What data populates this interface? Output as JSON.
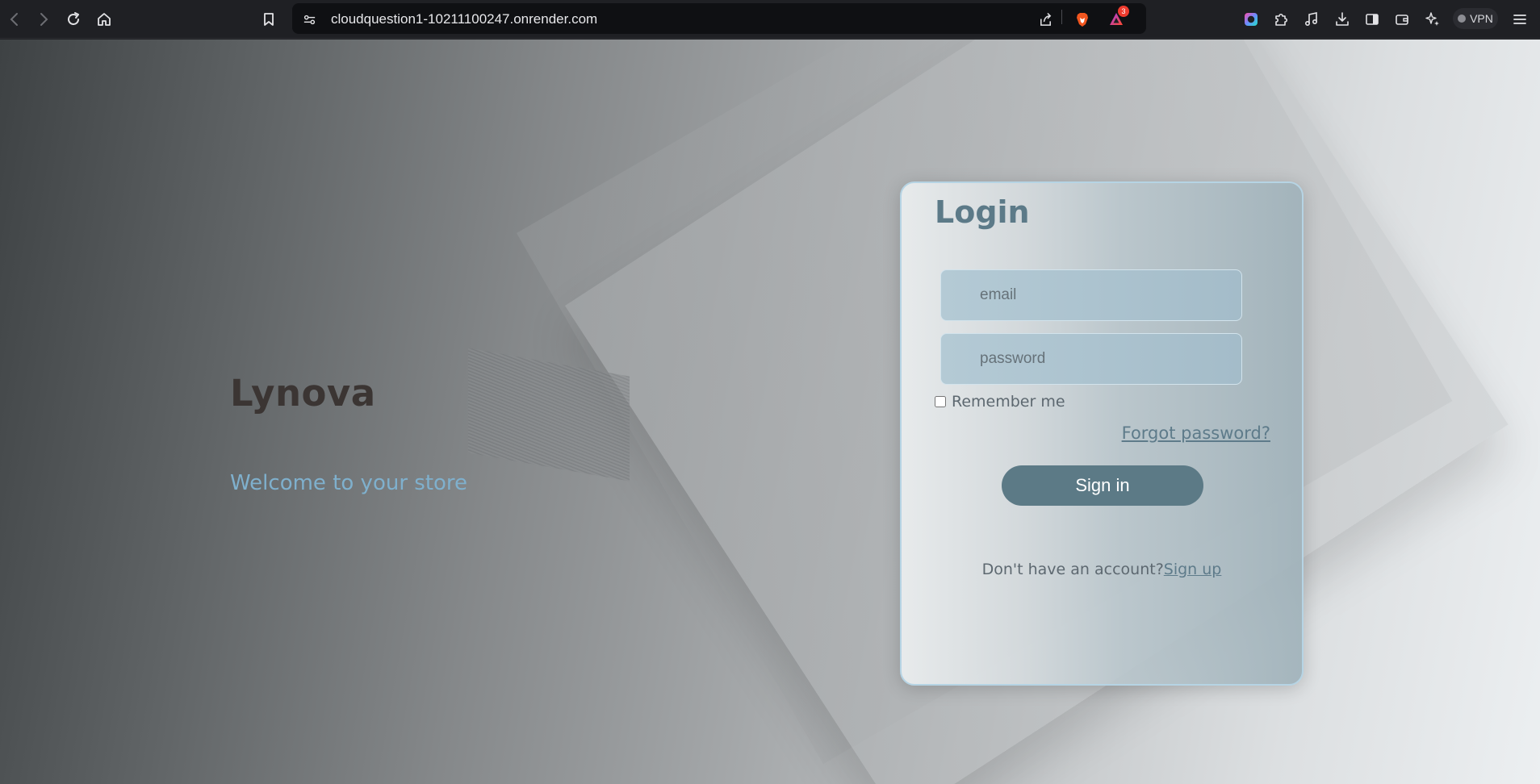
{
  "browser": {
    "url": "cloudquestion1-10211100247.onrender.com",
    "rewards_count": "3",
    "vpn_label": "VPN",
    "icons": [
      "back-arrow-icon",
      "forward-arrow-icon",
      "reload-icon",
      "home-icon",
      "bookmark-icon",
      "site-settings-icon",
      "share-icon",
      "brave-shield-icon",
      "brave-rewards-icon",
      "leo-ai-icon",
      "extensions-icon",
      "media-icon",
      "downloads-icon",
      "sidebar-icon",
      "wallet-icon",
      "sparkle-icon",
      "menu-icon"
    ]
  },
  "hero": {
    "brand": "Lynova",
    "tagline": "Welcome to your store"
  },
  "login": {
    "title": "Login",
    "email_placeholder": "email",
    "password_placeholder": "password",
    "remember_label": "Remember me",
    "forgot_label": "Forgot password?",
    "signin_label": "Sign in",
    "no_account_text": "Don't have an account?",
    "signup_label": "Sign up"
  },
  "colors": {
    "accent": "#5c7a86",
    "tagline": "#7fb0cd",
    "card_border": "#b6d4e4"
  }
}
